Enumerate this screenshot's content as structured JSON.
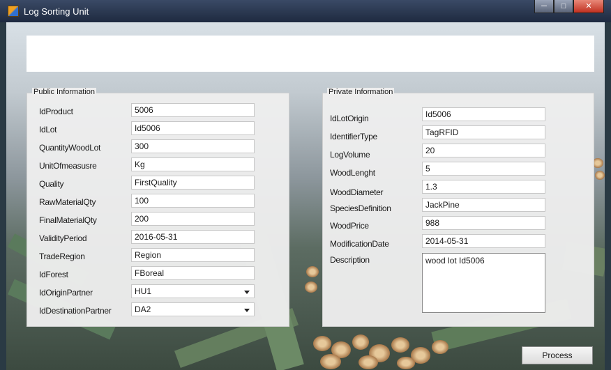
{
  "window": {
    "title": "Log Sorting Unit",
    "icon": "app-icon",
    "controls": {
      "minimize": "minimize-icon",
      "maximize": "maximize-icon",
      "close": "close-icon"
    }
  },
  "public_info": {
    "title": "Public Information",
    "fields": [
      {
        "label": "IdProduct",
        "value": "5006"
      },
      {
        "label": "IdLot",
        "value": "Id5006"
      },
      {
        "label": "QuantityWoodLot",
        "value": "300"
      },
      {
        "label": "UnitOfmeasusre",
        "value": "Kg"
      },
      {
        "label": "Quality",
        "value": "FirstQuality"
      },
      {
        "label": "RawMaterialQty",
        "value": "100"
      },
      {
        "label": "FinalMaterialQty",
        "value": "200"
      },
      {
        "label": "ValidityPeriod",
        "value": "2016-05-31"
      },
      {
        "label": "TradeRegion",
        "value": "Region"
      },
      {
        "label": "IdForest",
        "value": "FBoreal"
      },
      {
        "label": "IdOriginPartner",
        "value": "HU1"
      },
      {
        "label": "IdDestinationPartner",
        "value": "DA2"
      }
    ]
  },
  "private_info": {
    "title": "Private Information",
    "fields": [
      {
        "label": "IdLotOrigin",
        "value": "Id5006"
      },
      {
        "label": "IdentifierType",
        "value": "TagRFID"
      },
      {
        "label": "LogVolume",
        "value": "20"
      },
      {
        "label": "WoodLenght",
        "value": "5"
      },
      {
        "label": "WoodDiameter",
        "value": "1.3"
      },
      {
        "label": "SpeciesDefinition",
        "value": "JackPine"
      },
      {
        "label": "WoodPrice",
        "value": "988"
      },
      {
        "label": "ModificationDate",
        "value": "2014-05-31"
      },
      {
        "label": "Description",
        "value": "wood lot Id5006"
      }
    ]
  },
  "actions": {
    "process_label": "Process"
  }
}
